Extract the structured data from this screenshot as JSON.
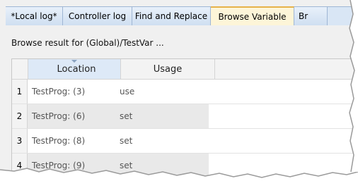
{
  "tabs": [
    {
      "label": "*Local log*",
      "active": false
    },
    {
      "label": "Controller log",
      "active": false
    },
    {
      "label": "Find and Replace",
      "active": false
    },
    {
      "label": "Browse Variable",
      "active": true
    },
    {
      "label": "Br",
      "active": false
    }
  ],
  "panel": {
    "result_label": "Browse result for (Global)/TestVar ..."
  },
  "table": {
    "columns": [
      "Location",
      "Usage"
    ],
    "rows": [
      {
        "num": "1",
        "location": "TestProg: (3)",
        "usage": "use"
      },
      {
        "num": "2",
        "location": "TestProg: (6)",
        "usage": "set"
      },
      {
        "num": "3",
        "location": "TestProg: (8)",
        "usage": "set"
      },
      {
        "num": "4",
        "location": "TestProg: (9)",
        "usage": "set"
      }
    ]
  },
  "colors": {
    "tab_strip": "#d9e6f5",
    "active_tab": "#fdf5d8",
    "active_accent": "#e6b24a",
    "alt_row": "#e9e9e9"
  }
}
